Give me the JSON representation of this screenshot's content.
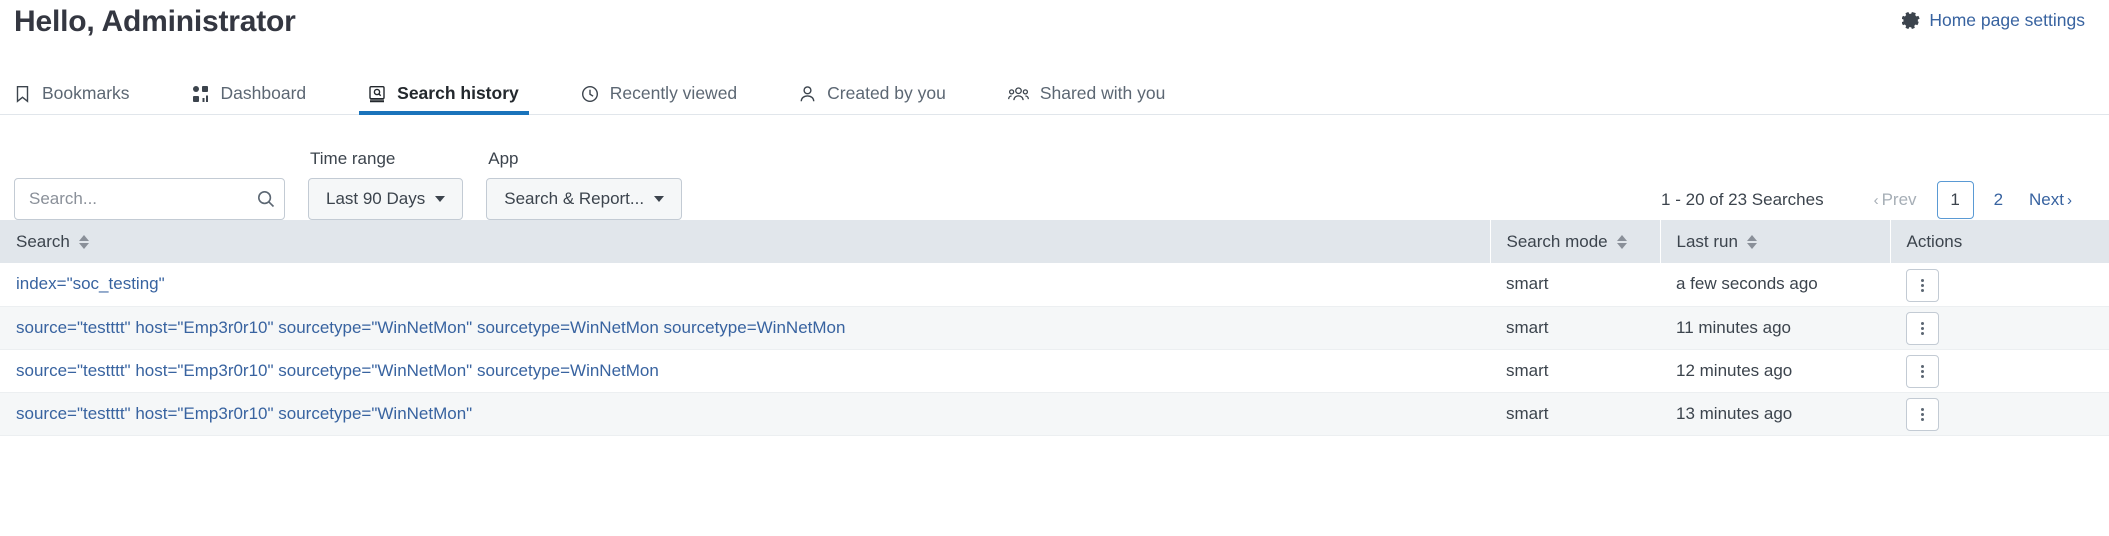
{
  "header": {
    "greeting": "Hello, Administrator",
    "home_settings_label": "Home page settings",
    "gear_icon": "gear-icon"
  },
  "tabs": [
    {
      "label": "Bookmarks",
      "icon": "bookmark-icon",
      "active": false
    },
    {
      "label": "Dashboard",
      "icon": "dashboard-grid-icon",
      "active": false
    },
    {
      "label": "Search history",
      "icon": "search-history-icon",
      "active": true
    },
    {
      "label": "Recently viewed",
      "icon": "clock-icon",
      "active": false
    },
    {
      "label": "Created by you",
      "icon": "user-icon",
      "active": false
    },
    {
      "label": "Shared with you",
      "icon": "users-group-icon",
      "active": false
    }
  ],
  "controls": {
    "search": {
      "placeholder": "Search...",
      "value": "",
      "icon": "search-icon"
    },
    "time_range": {
      "label": "Time range",
      "selected": "Last 90 Days",
      "caret_icon": "caret-down-icon"
    },
    "app": {
      "label": "App",
      "selected": "Search & Report...",
      "caret_icon": "caret-down-icon"
    }
  },
  "pagination": {
    "summary": "1 - 20 of 23 Searches",
    "prev_label": "Prev",
    "next_label": "Next",
    "prev_icon": "chevron-left-icon",
    "next_icon": "chevron-right-icon",
    "pages": [
      "1",
      "2"
    ],
    "current_page": "1",
    "prev_disabled": true
  },
  "table": {
    "columns": [
      {
        "label": "Search",
        "sortable": true,
        "sort_icon": "sort-arrows-icon"
      },
      {
        "label": "Search mode",
        "sortable": true,
        "sort_icon": "sort-arrows-icon"
      },
      {
        "label": "Last run",
        "sortable": true,
        "sort_icon": "sort-arrows-icon"
      },
      {
        "label": "Actions",
        "sortable": false,
        "sort_icon": ""
      }
    ],
    "rows": [
      {
        "search": "index=\"soc_testing\"",
        "mode": "smart",
        "last_run": "a few seconds ago",
        "action_icon": "kebab-menu-icon"
      },
      {
        "search": "source=\"testttt\" host=\"Emp3r0r10\" sourcetype=\"WinNetMon\" sourcetype=WinNetMon sourcetype=WinNetMon",
        "mode": "smart",
        "last_run": "11 minutes ago",
        "action_icon": "kebab-menu-icon"
      },
      {
        "search": "source=\"testttt\" host=\"Emp3r0r10\" sourcetype=\"WinNetMon\" sourcetype=WinNetMon",
        "mode": "smart",
        "last_run": "12 minutes ago",
        "action_icon": "kebab-menu-icon"
      },
      {
        "search": "source=\"testttt\" host=\"Emp3r0r10\" sourcetype=\"WinNetMon\"",
        "mode": "smart",
        "last_run": "13 minutes ago",
        "action_icon": "kebab-menu-icon"
      }
    ]
  },
  "colors": {
    "link": "#3863a0",
    "accent": "#1a73bb",
    "header_bg": "#e1e6eb",
    "row_alt": "#f5f7f8",
    "text": "#3c444d",
    "muted": "#8a9099"
  }
}
